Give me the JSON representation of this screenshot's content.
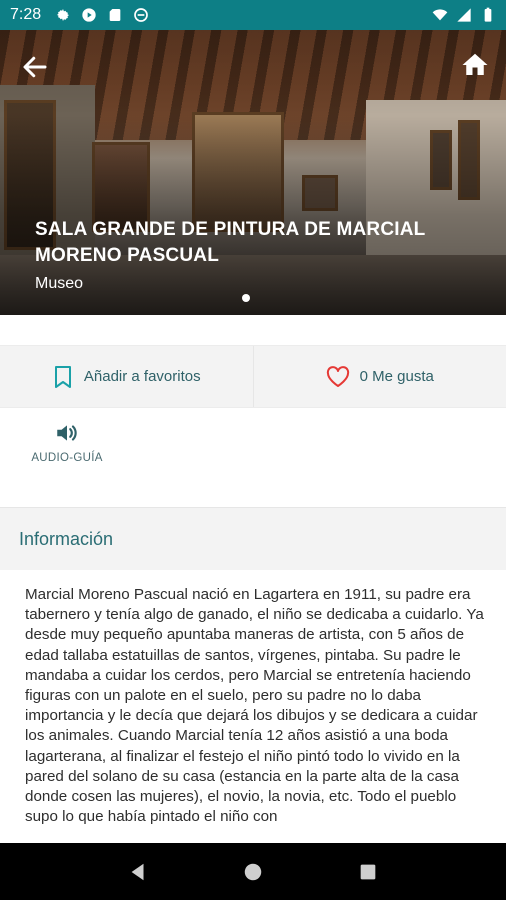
{
  "status_bar": {
    "time": "7:28",
    "left_icons": [
      "gear-icon",
      "play-store-icon",
      "sd-card-icon",
      "no-disturb-icon"
    ],
    "right_icons": [
      "wifi-icon",
      "signal-icon",
      "battery-icon"
    ]
  },
  "hero": {
    "title": "SALA GRANDE DE PINTURA DE MARCIAL MORENO PASCUAL",
    "subtitle": "Museo",
    "carousel_pages": 1,
    "carousel_active": 1
  },
  "actions": {
    "favorites_label": "Añadir a favoritos",
    "likes_label": "0 Me gusta"
  },
  "audio_guide": {
    "label": "AUDIO-GUÍA"
  },
  "info": {
    "title": "Información",
    "body": "Marcial Moreno Pascual nació en Lagartera en 1911, su padre era tabernero y tenía algo de ganado, el niño se dedicaba a cuidarlo. Ya desde muy pequeño apuntaba maneras de artista, con 5 años de edad  tallaba estatuillas de santos, vírgenes, pintaba.  Su padre le mandaba a cuidar los cerdos, pero Marcial se entretenía haciendo figuras con un palote en el suelo, pero su padre no lo daba importancia y le decía que dejará los dibujos y se dedicara a cuidar los animales. Cuando Marcial tenía 12 años asistió a una boda lagarterana, al finalizar el festejo el niño pintó todo lo vivido en la pared del solano de su casa (estancia en la parte alta de la casa donde cosen las mujeres), el novio, la novia, etc. Todo el pueblo supo lo que había pintado el niño con"
  },
  "colors": {
    "status_bar": "#0d7f86",
    "accent_teal": "#2a6d74",
    "heart_red": "#e53935",
    "panel_gray": "#f3f3f3"
  }
}
